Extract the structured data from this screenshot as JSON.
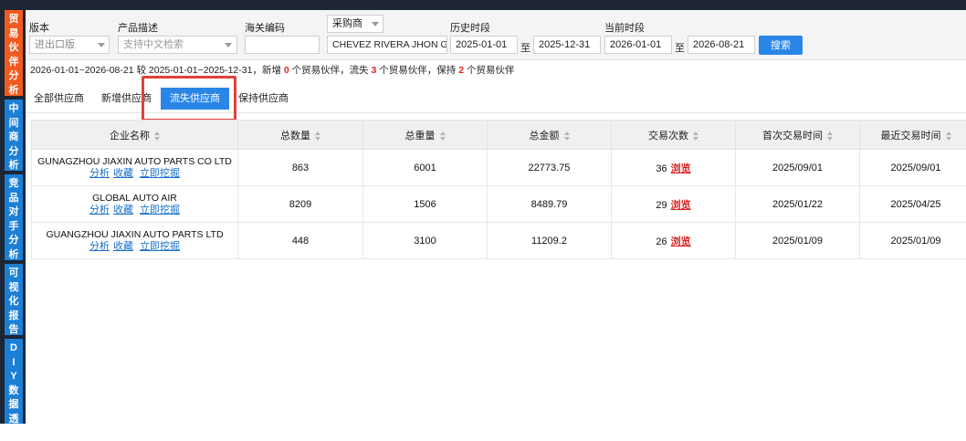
{
  "sidebar": {
    "tabs": [
      {
        "label": "贸易伙伴分析",
        "color": "#f05a1e"
      },
      {
        "label": "中间商分析",
        "color": "#1c7fd6"
      },
      {
        "label": "竞品对手分析",
        "color": "#1c7fd6"
      },
      {
        "label": "可视化报告",
        "color": "#1c7fd6"
      },
      {
        "label": "DIY数据透视",
        "color": "#1c7fd6"
      }
    ]
  },
  "filters": {
    "version_label": "版本",
    "version_value": "进出口版",
    "product_label": "产品描述",
    "product_placeholder": "支持中文检索",
    "hs_label": "海关编码",
    "hs_value": "",
    "buyer_select": "采购商",
    "buyer_value": "CHEVEZ RIVERA JHON G",
    "history_label": "历史时段",
    "history_start": "2025-01-01",
    "history_to": "至",
    "history_end": "2025-12-31",
    "current_label": "当前时段",
    "current_start": "2026-01-01",
    "current_to": "至",
    "current_end": "2026-08-21",
    "search_button": "搜索"
  },
  "summary": {
    "p1": "2026-01-01~2026-08-21 较 2025-01-01~2025-12-31，新增 ",
    "new_count": "0",
    "p2": " 个贸易伙伴，流失 ",
    "lost_count": "3",
    "p3": " 个贸易伙伴，保持 ",
    "kept_count": "2",
    "p4": " 个贸易伙伴"
  },
  "tabs": [
    {
      "label": "全部供应商",
      "active": false
    },
    {
      "label": "新增供应商",
      "active": false
    },
    {
      "label": "流失供应商",
      "active": true
    },
    {
      "label": "保持供应商",
      "active": false
    }
  ],
  "table": {
    "columns": [
      "企业名称",
      "总数量",
      "总重量",
      "总金额",
      "交易次数",
      "首次交易时间",
      "最近交易时间"
    ],
    "link_analyze": "分析",
    "link_favorite": "收藏",
    "link_mine": "立即挖掘",
    "view_label": "浏览",
    "rows": [
      {
        "name": "GUNAGZHOU JIAXIN AUTO PARTS CO LTD",
        "qty": "863",
        "weight": "6001",
        "amount": "22773.75",
        "count": "36",
        "first": "2025/09/01",
        "last": "2025/09/01"
      },
      {
        "name": "GLOBAL AUTO AIR",
        "qty": "8209",
        "weight": "1506",
        "amount": "8489.79",
        "count": "29",
        "first": "2025/01/22",
        "last": "2025/04/25"
      },
      {
        "name": "GUANGZHOU JIAXIN AUTO PARTS LTD",
        "qty": "448",
        "weight": "3100",
        "amount": "11209.2",
        "count": "26",
        "first": "2025/01/09",
        "last": "2025/01/09"
      }
    ]
  },
  "colors": {
    "accent": "#2a86e6",
    "sidebar_bg": "#1e2533",
    "highlight": "#e2403c",
    "danger": "#d92121"
  }
}
